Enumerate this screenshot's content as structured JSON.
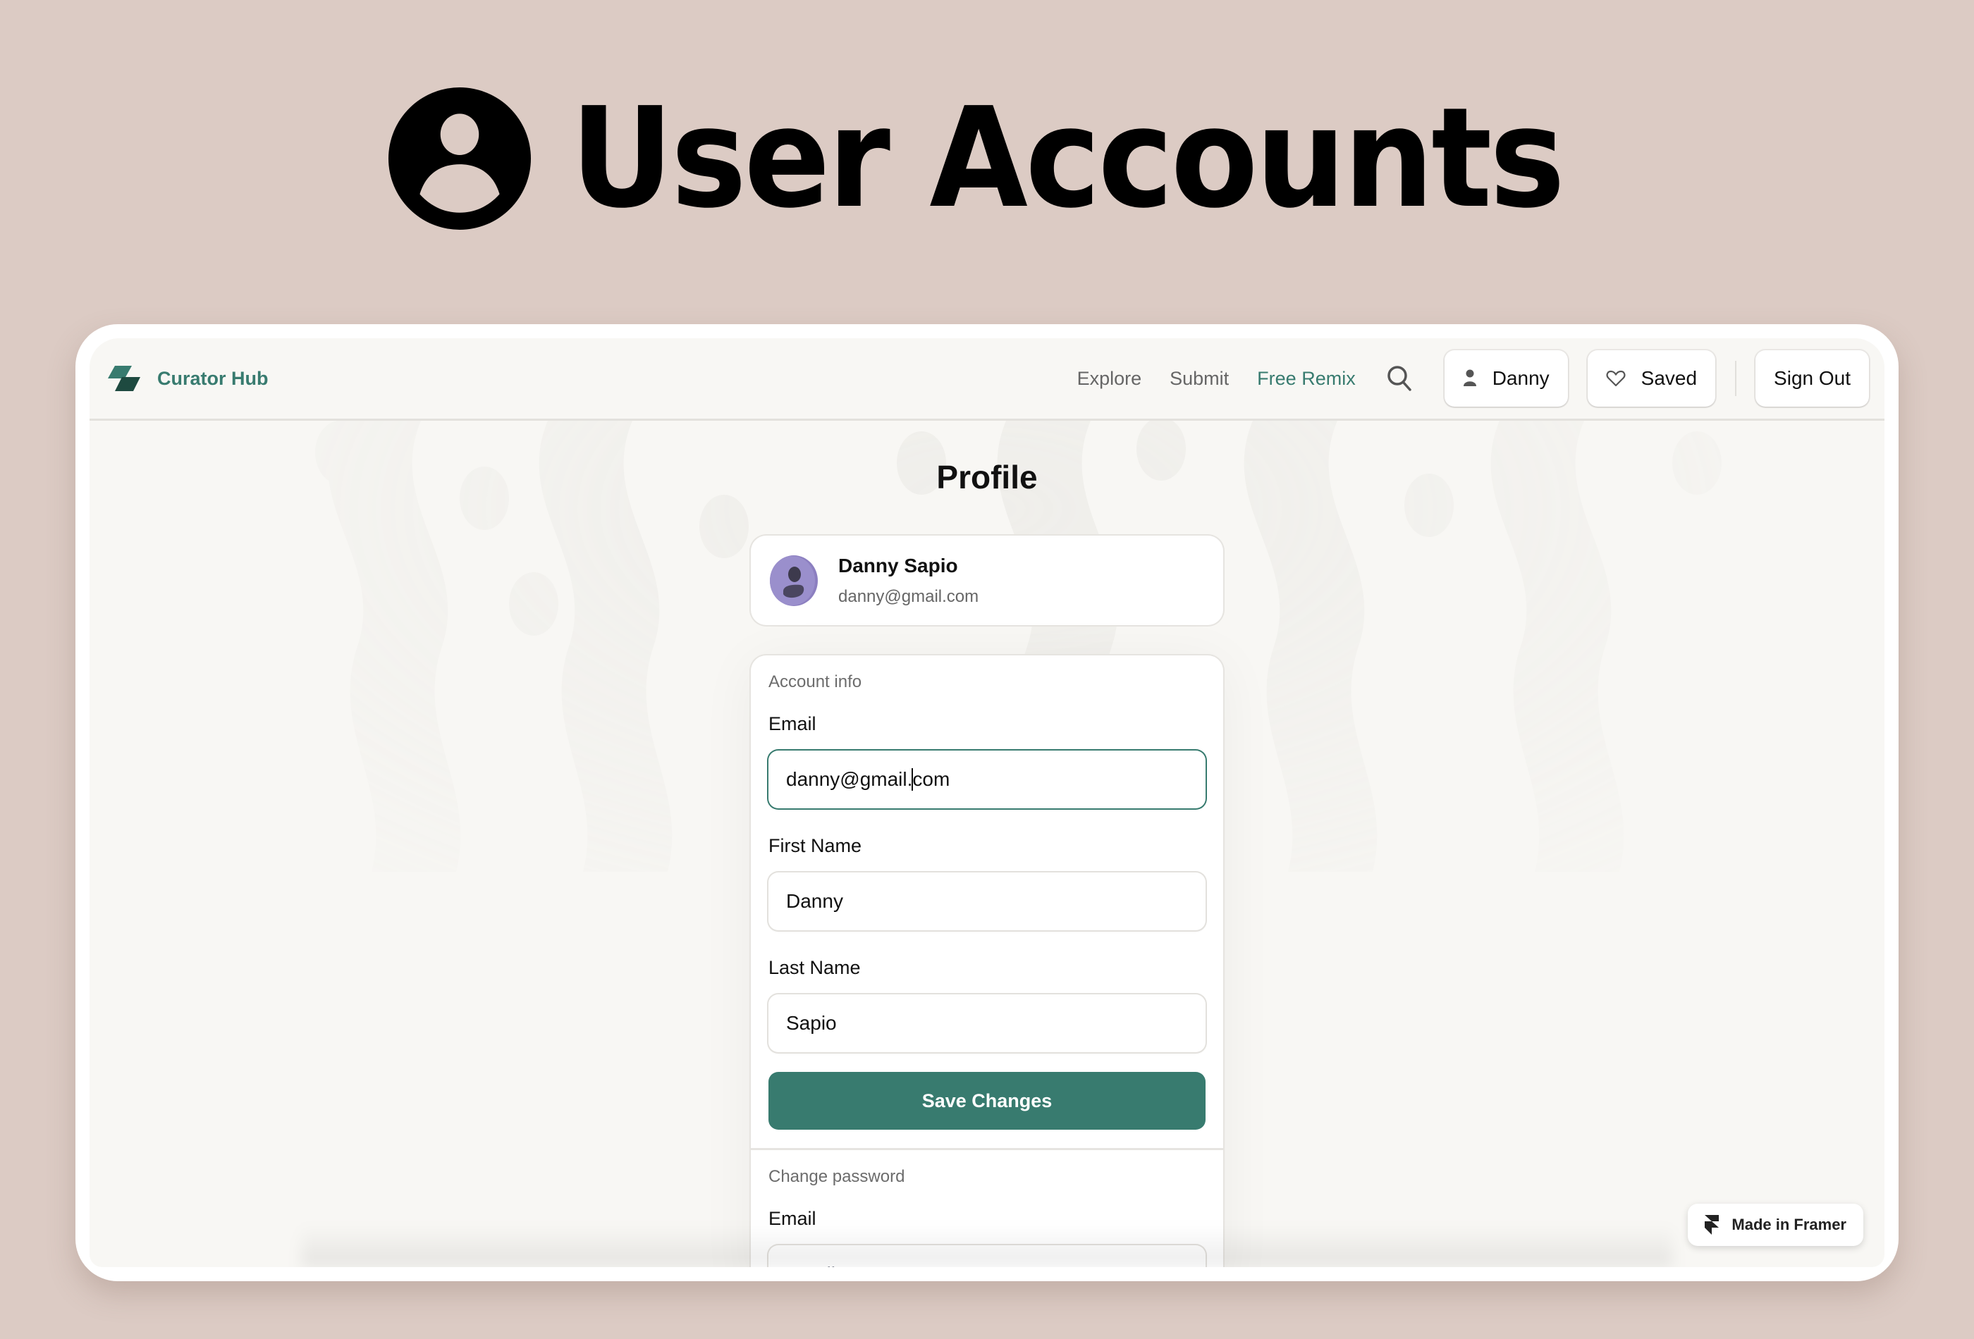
{
  "hero": {
    "icon": "user-circle-icon",
    "title": "User Accounts"
  },
  "header": {
    "brand_name": "Curator Hub",
    "brand_logo": "stacked-parallelogram-logo",
    "nav": [
      {
        "label": "Explore"
      },
      {
        "label": "Submit"
      },
      {
        "label": "Free Remix"
      }
    ],
    "search_icon": "search-icon",
    "account_button": {
      "icon": "person-icon",
      "label": "Danny"
    },
    "saved_button": {
      "icon": "heart-icon",
      "label": "Saved"
    },
    "sign_out_label": "Sign Out"
  },
  "page": {
    "title": "Profile"
  },
  "user_card": {
    "name": "Danny Sapio",
    "email": "danny@gmail.com"
  },
  "account_info": {
    "section_label": "Account info",
    "email": {
      "label": "Email",
      "value_before_caret": "danny@gmail.",
      "value_after_caret": "com"
    },
    "first_name": {
      "label": "First Name",
      "value": "Danny"
    },
    "last_name": {
      "label": "Last Name",
      "value": "Sapio"
    },
    "save_label": "Save Changes"
  },
  "change_password": {
    "section_label": "Change password",
    "email": {
      "label": "Email",
      "placeholder": "Email"
    }
  },
  "framer_badge": {
    "icon": "framer-icon",
    "label": "Made in Framer"
  },
  "colors": {
    "accent": "#387b6f",
    "background": "#dccbc4",
    "app_background": "#f8f7f4",
    "avatar": "#8c7fc0"
  }
}
